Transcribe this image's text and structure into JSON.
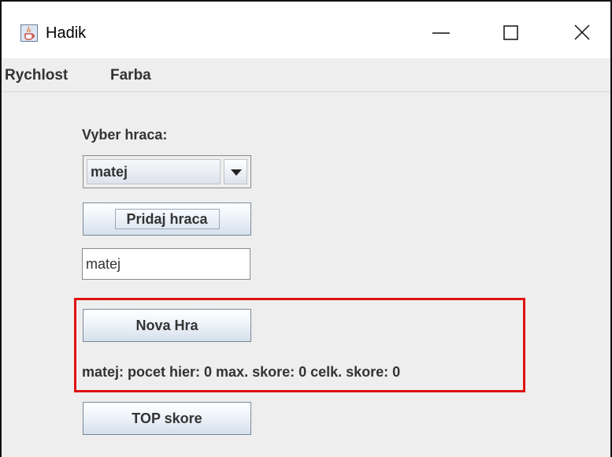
{
  "window": {
    "title": "Hadik",
    "app_icon": "java-cup-icon",
    "controls": [
      "minimize-icon",
      "maximize-icon",
      "close-icon"
    ]
  },
  "menubar": {
    "items": [
      {
        "label": "Rychlost"
      },
      {
        "label": "Farba"
      }
    ]
  },
  "main": {
    "player_label": "Vyber hraca:",
    "player_select": {
      "selected": "matej"
    },
    "add_player_button": "Pridaj hraca",
    "name_input": {
      "value": "matej"
    },
    "new_game_button": "Nova Hra",
    "stats_text": "matej: pocet hier: 0 max. skore: 0 celk. skore: 0",
    "top_score_button": "TOP skore"
  },
  "colors": {
    "highlight_border": "#e01010",
    "button_gradient_top": "#ffffff",
    "button_gradient_bottom": "#d5e0ec",
    "window_background": "#eeeeee"
  }
}
